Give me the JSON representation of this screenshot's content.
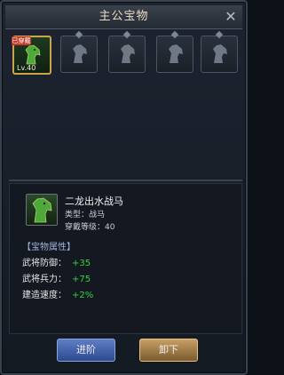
{
  "window": {
    "title": "主公宝物"
  },
  "slots": [
    {
      "badge": "已穿戴",
      "level": "Lv.40",
      "active": true,
      "icon": "horse-head-icon"
    },
    {
      "icon": "horse-head-icon"
    },
    {
      "icon": "horse-head-icon"
    },
    {
      "icon": "horse-head-icon"
    },
    {
      "icon": "horse-head-icon"
    }
  ],
  "item": {
    "name": "二龙出水战马",
    "type": "类型：战马",
    "wear_level": "穿戴等级：40"
  },
  "attributes": {
    "title": "【宝物属性】",
    "rows": [
      {
        "label": "武将防御：",
        "value": "+35"
      },
      {
        "label": "武将兵力：",
        "value": "+75"
      },
      {
        "label": "建造速度：",
        "value": "+2%"
      }
    ]
  },
  "buttons": {
    "advance": "进阶",
    "unload": "卸下"
  },
  "colors": {
    "accent_green": "#39d13b",
    "title_gold": "#e9dcc0",
    "button_blue": "#2c4b8f",
    "button_gold": "#7b5a2d"
  }
}
